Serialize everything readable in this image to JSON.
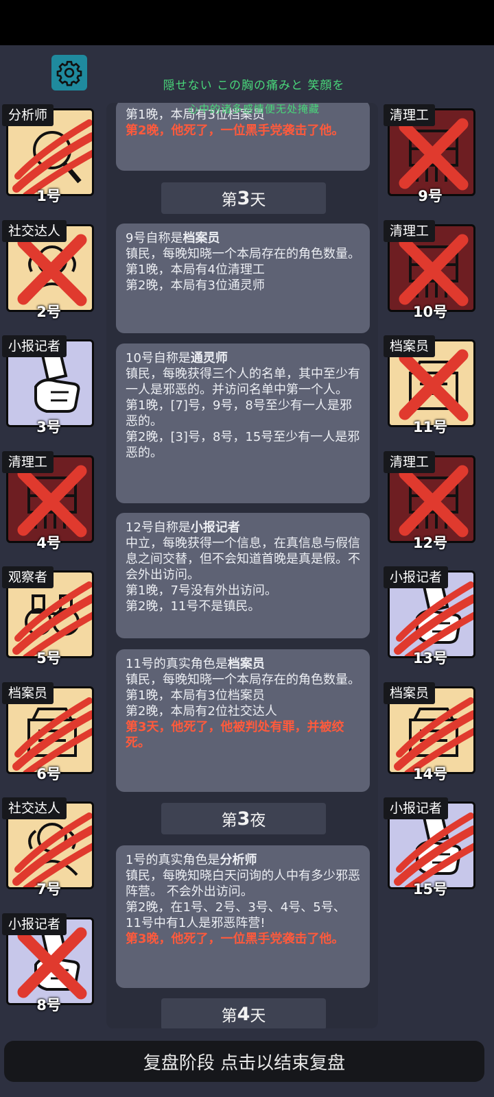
{
  "header": {
    "lyric_line1": "隠せない この胸の痛みと 笑顔を",
    "lyric_line2": "心中的诸多感情便无处掩藏"
  },
  "players_left": [
    {
      "role": "分析师",
      "number": "1号",
      "team": "town",
      "icon": "magnifier-icon",
      "status": "claw"
    },
    {
      "role": "社交达人",
      "number": "2号",
      "team": "town",
      "icon": "socialite-icon",
      "status": "cross"
    },
    {
      "role": "小报记者",
      "number": "3号",
      "team": "neutral",
      "icon": "newspaper-hand-icon",
      "status": "alive"
    },
    {
      "role": "清理工",
      "number": "4号",
      "team": "mafia",
      "icon": "shredder-icon",
      "status": "cross"
    },
    {
      "role": "观察者",
      "number": "5号",
      "team": "town",
      "icon": "binoculars-icon",
      "status": "claw"
    },
    {
      "role": "档案员",
      "number": "6号",
      "team": "town",
      "icon": "archive-icon",
      "status": "claw"
    },
    {
      "role": "社交达人",
      "number": "7号",
      "team": "town",
      "icon": "socialite-icon",
      "status": "claw"
    },
    {
      "role": "小报记者",
      "number": "8号",
      "team": "neutral",
      "icon": "newspaper-hand-icon",
      "status": "cross"
    }
  ],
  "players_right": [
    {
      "role": "清理工",
      "number": "9号",
      "team": "mafia",
      "icon": "shredder-icon",
      "status": "cross"
    },
    {
      "role": "清理工",
      "number": "10号",
      "team": "mafia",
      "icon": "shredder-icon",
      "status": "cross"
    },
    {
      "role": "档案员",
      "number": "11号",
      "team": "town",
      "icon": "archive-icon",
      "status": "cross"
    },
    {
      "role": "清理工",
      "number": "12号",
      "team": "mafia",
      "icon": "shredder-icon",
      "status": "cross"
    },
    {
      "role": "小报记者",
      "number": "13号",
      "team": "neutral",
      "icon": "newspaper-hand-icon",
      "status": "claw"
    },
    {
      "role": "档案员",
      "number": "14号",
      "team": "town",
      "icon": "archive-icon",
      "status": "claw"
    },
    {
      "role": "小报记者",
      "number": "15号",
      "team": "neutral",
      "icon": "newspaper-hand-icon",
      "status": "claw"
    }
  ],
  "feed": {
    "card0": {
      "line1": "第1晚，本局有3位档案员",
      "red": "第2晚，他死了，一位黑手党袭击了他。"
    },
    "sep_day3": {
      "prefix": "第",
      "num": "3",
      "suffix": "天"
    },
    "card1": {
      "pre": "9号自称是",
      "role": "档案员",
      "l2": "镇民，每晚知晓一个本局存在的角色数量。",
      "l3": "第1晚，本局有4位清理工",
      "l4": "第2晚，本局有3位通灵师"
    },
    "card2": {
      "pre": "10号自称是",
      "role": "通灵师",
      "l2": "镇民，每晚获得三个人的名单，其中至少有一人是邪恶的。并访问名单中第一个人。",
      "l3": "第1晚，[7]号，9号，8号至少有一人是邪恶的。",
      "l4": "第2晚，[3]号，8号，15号至少有一人是邪恶的。"
    },
    "card3": {
      "pre": "12号自称是",
      "role": "小报记者",
      "l2": "中立，每晚获得一个信息，在真信息与假信息之间交替，但不会知道首晚是真是假。不会外出访问。",
      "l3": "第1晚，7号没有外出访问。",
      "l4": "第2晚，11号不是镇民。"
    },
    "card4": {
      "pre": "11号的真实角色是",
      "role": "档案员",
      "l2": "镇民，每晚知晓一个本局存在的角色数量。",
      "l3": "第1晚，本局有3位档案员",
      "l4": "第2晚，本局有2位社交达人",
      "red": "第3天，他死了，他被判处有罪，并被绞死。"
    },
    "sep_night3": {
      "prefix": "第",
      "num": "3",
      "suffix": "夜"
    },
    "card5": {
      "pre": "1号的真实角色是",
      "role": "分析师",
      "l2": "镇民，每晚知晓白天问询的人中有多少邪恶阵营。 不会外出访问。",
      "l3": "第2晚，在1号、2号、3号、4号、5号、11号中有1人是邪恶阵营!",
      "red": "第3晚，他死了，一位黑手党袭击了他。"
    },
    "sep_day4": {
      "prefix": "第",
      "num": "4",
      "suffix": "天"
    }
  },
  "footer": {
    "label": "复盘阶段 点击以结束复盘"
  },
  "colors": {
    "town": "#f4d9a2",
    "neutral": "#c7c7ea",
    "mafia": "#6e1e22",
    "mark": "#e03a2e",
    "death_text": "#ff5a3c",
    "accent": "#1f8a9e"
  }
}
